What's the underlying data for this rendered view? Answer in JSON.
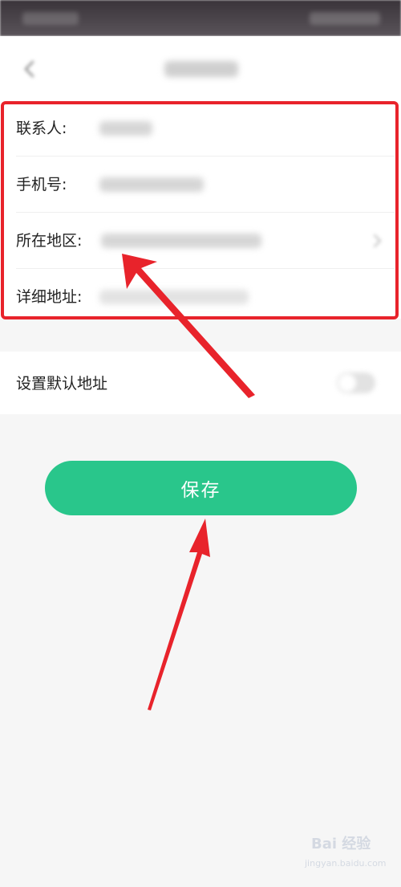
{
  "form": {
    "contact_label": "联系人:",
    "phone_label": "手机号:",
    "region_label": "所在地区:",
    "address_label": "详细地址:"
  },
  "default_address": {
    "label": "设置默认地址",
    "enabled": false
  },
  "actions": {
    "save_label": "保存"
  },
  "watermark": {
    "logo_text": "Bai 经验",
    "url_text": "jingyan.baidu.com"
  },
  "colors": {
    "accent": "#29c68b",
    "annotation_red": "#e8232b",
    "background": "#f6f6f6"
  },
  "icons": {
    "back": "back-arrow-icon",
    "chevron": "chevron-right-icon"
  }
}
